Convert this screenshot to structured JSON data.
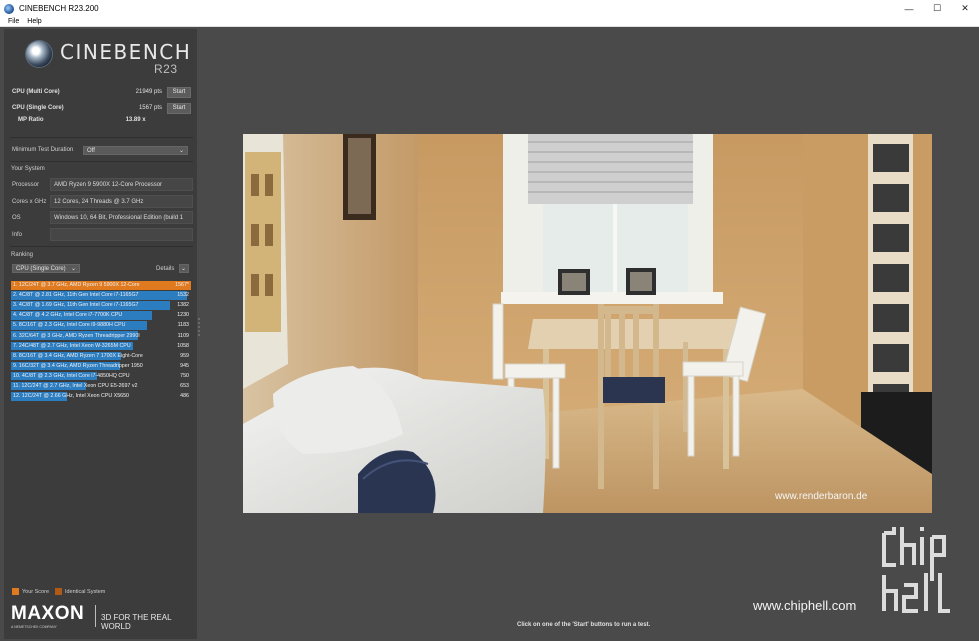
{
  "window": {
    "title": "CINEBENCH R23.200",
    "minimize": "—",
    "maximize": "☐",
    "close": "✕"
  },
  "menu": {
    "file": "File",
    "help": "Help"
  },
  "logo": {
    "name": "CINEBENCH",
    "version": "R23"
  },
  "scores": {
    "multi": {
      "label": "CPU (Multi Core)",
      "value": "21949 pts",
      "button": "Start"
    },
    "single": {
      "label": "CPU (Single Core)",
      "value": "1567 pts",
      "button": "Start"
    },
    "mp": {
      "label": "MP Ratio",
      "value": "13.89 x"
    }
  },
  "min_duration": {
    "label": "Minimum Test Duration",
    "value": "Off"
  },
  "system": {
    "title": "Your System",
    "rows": [
      {
        "key": "Processor",
        "value": "AMD Ryzen 9 5900X 12-Core Processor"
      },
      {
        "key": "Cores x GHz",
        "value": "12 Cores, 24 Threads @ 3.7 GHz"
      },
      {
        "key": "OS",
        "value": "Windows 10, 64 Bit, Professional Edition (build 1"
      },
      {
        "key": "Info",
        "value": ""
      }
    ]
  },
  "ranking": {
    "title": "Ranking",
    "mode": "CPU (Single Core)",
    "details": "Details",
    "items": [
      {
        "text": "1. 12C/24T @ 3.7 GHz, AMD Ryzen 9 5900X 12-Core",
        "score": "1567*",
        "value": 1567,
        "mine": true
      },
      {
        "text": "2. 4C/8T @ 2.81 GHz, 11th Gen Intel Core i7-1165G7",
        "score": "1532",
        "value": 1532,
        "mine": false
      },
      {
        "text": "3. 4C/8T @ 1.69 GHz, 11th Gen Intel Core i7-1165G7",
        "score": "1382",
        "value": 1382,
        "mine": false
      },
      {
        "text": "4. 4C/8T @ 4.2 GHz, Intel Core i7-7700K CPU",
        "score": "1230",
        "value": 1230,
        "mine": false
      },
      {
        "text": "5. 8C/16T @ 2.3 GHz, Intel Core i9-9880H CPU",
        "score": "1183",
        "value": 1183,
        "mine": false
      },
      {
        "text": "6. 32C/64T @ 3 GHz, AMD Ryzen Threadripper 2990I",
        "score": "1109",
        "value": 1109,
        "mine": false
      },
      {
        "text": "7. 24C/48T @ 2.7 GHz, Intel Xeon W-3265M CPU",
        "score": "1058",
        "value": 1058,
        "mine": false
      },
      {
        "text": "8. 8C/16T @ 3.4 GHz, AMD Ryzen 7 1700X Eight-Core",
        "score": "959",
        "value": 959,
        "mine": false
      },
      {
        "text": "9. 16C/32T @ 3.4 GHz, AMD Ryzen Threadripper 1950",
        "score": "945",
        "value": 945,
        "mine": false
      },
      {
        "text": "10. 4C/8T @ 2.3 GHz, Intel Core i7-4850HQ CPU",
        "score": "750",
        "value": 750,
        "mine": false
      },
      {
        "text": "11. 12C/24T @ 2.7 GHz, Intel Xeon CPU E5-2697 v2",
        "score": "653",
        "value": 653,
        "mine": false
      },
      {
        "text": "12. 12C/24T @ 2.66 GHz, Intel Xeon CPU X5650",
        "score": "486",
        "value": 486,
        "mine": false
      }
    ]
  },
  "legend": {
    "your_score": "Your Score",
    "identical": "Identical System",
    "your_color": "#e07a1f",
    "identical_color": "#b05a18"
  },
  "brand": {
    "name": "MAXON",
    "sub": "A NEMETSCHEK COMPANY",
    "tagline": "3D FOR THE REAL WORLD"
  },
  "render": {
    "credit": "www.renderbaron.de"
  },
  "status": "Click on one of the 'Start' buttons to run a test.",
  "watermark": {
    "url": "www.chiphell.com",
    "logo_text": "chip hell"
  }
}
